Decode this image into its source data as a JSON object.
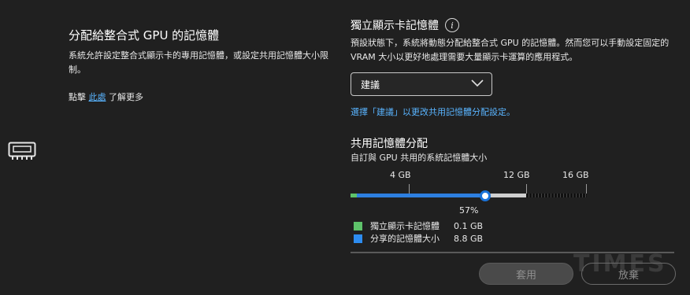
{
  "left": {
    "title": "分配給整合式 GPU 的記憶體",
    "description": "系統允許設定整合式顯示卡的專用記憶體，或設定共用記憶體大小限制。",
    "link_prefix": "點擊",
    "link_text": "此處",
    "link_suffix": "了解更多",
    "icon": "memory-chip-icon"
  },
  "right": {
    "title": "獨立顯示卡記憶體",
    "info_glyph": "i",
    "description": "預設狀態下，系統將動態分配給整合式 GPU 的記憶體。然而您可以手動設定固定的 VRAM 大小以更好地處理需要大量顯示卡運算的應用程式。",
    "select": {
      "selected": "建議"
    },
    "hint": "選擇「建議」以更改共用記憶體分配設定。"
  },
  "shared": {
    "title": "共用記憶體分配",
    "subtitle": "自訂與 GPU 共用的系統記憶體大小",
    "ticks": [
      "4 GB",
      "12 GB",
      "16 GB"
    ],
    "percent_label": "57%",
    "percent_value": 0.57,
    "legend": [
      {
        "label": "獨立顯示卡記憶體",
        "value": "0.1 GB",
        "color": "#5ec26a"
      },
      {
        "label": "分享的記憶體大小",
        "value": "8.8 GB",
        "color": "#2d8cf0"
      }
    ],
    "track_colors": {
      "dedicated": "#5ec26a",
      "shared": "#2d7fe0",
      "remaining": "#cfcfcf",
      "reserved": "#111111"
    }
  },
  "buttons": {
    "apply": "套用",
    "cancel": "放棄"
  },
  "watermark": "TIMES"
}
